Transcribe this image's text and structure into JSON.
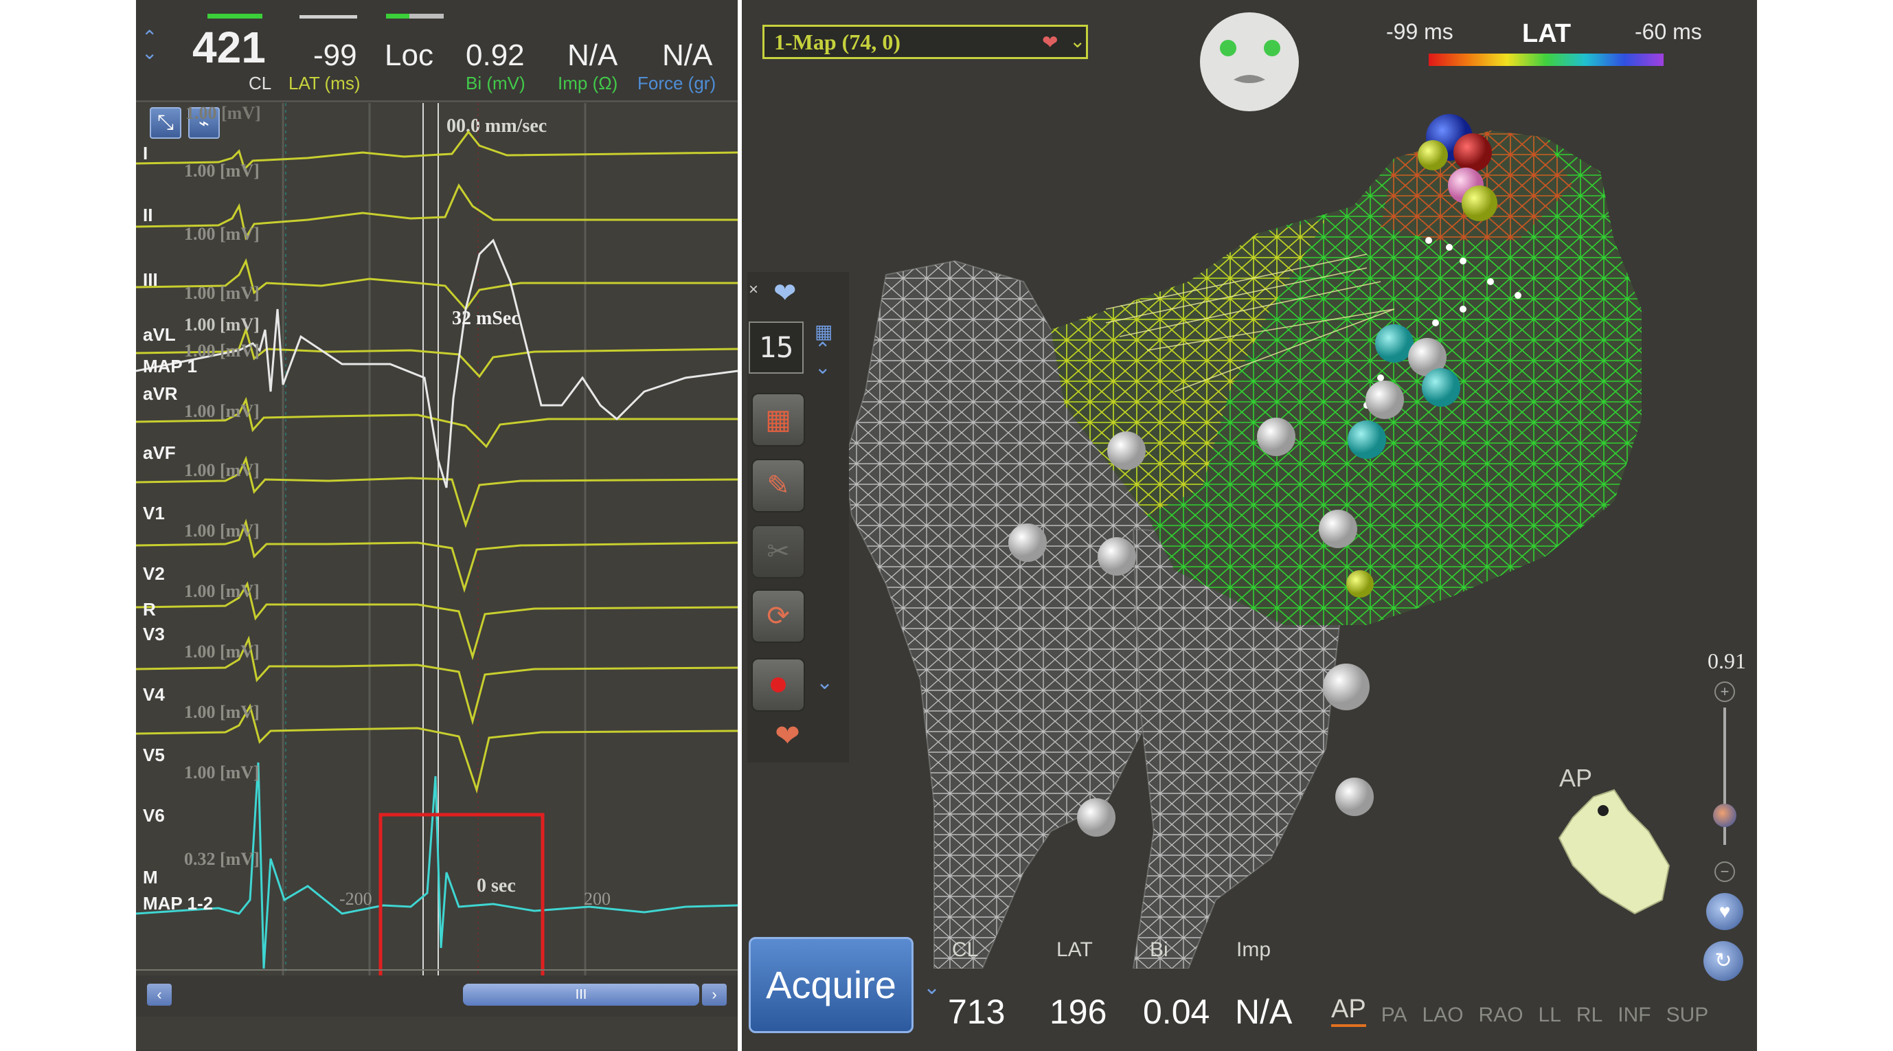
{
  "header": {
    "cl": {
      "value": "421",
      "label": "CL"
    },
    "lat": {
      "value": "-99",
      "label": "LAT (ms)"
    },
    "loc": {
      "value": "Loc"
    },
    "bi": {
      "value": "0.92",
      "label": "Bi (mV)"
    },
    "imp": {
      "value": "N/A",
      "label": "Imp (Ω)"
    },
    "force": {
      "value": "N/A",
      "label": "Force (gr)"
    }
  },
  "signals": {
    "sweep_speed": "00.0 mm/sec",
    "interval_label": "32 mSec",
    "time_label": "0 sec",
    "axis_left": "-200",
    "axis_right": "200",
    "top_gain": "1.00 [mV]",
    "leads": [
      {
        "name": "I",
        "gain": "1.00 [mV]"
      },
      {
        "name": "II",
        "gain": "1.00 [mV]"
      },
      {
        "name": "III",
        "gain": "1.00 [mV]"
      },
      {
        "name": "aVL",
        "gain": "1.00 [mV]"
      },
      {
        "name": "MAP 1",
        "gain": "1.00 [mV]"
      },
      {
        "name": "aVR",
        "gain": "1.00 [mV]"
      },
      {
        "name": "aVF",
        "gain": "1.00 [mV]"
      },
      {
        "name": "V1",
        "gain": "1.00 [mV]"
      },
      {
        "name": "V2",
        "gain": "1.00 [mV]"
      },
      {
        "name": "R",
        "gain": ""
      },
      {
        "name": "V3",
        "gain": "1.00 [mV]"
      },
      {
        "name": "V4",
        "gain": "1.00 [mV]"
      },
      {
        "name": "V5",
        "gain": "1.00 [mV]"
      },
      {
        "name": "V6",
        "gain": "1.00 [mV]"
      },
      {
        "name": "M",
        "gain": "0.32 [mV]"
      },
      {
        "name": "MAP 1-2",
        "gain": ""
      }
    ],
    "scrollbar_thumb": "III"
  },
  "map": {
    "title": "1-Map (74, 0)",
    "lat_min": "-99 ms",
    "lat_label": "LAT",
    "lat_max": "-60 ms",
    "point_count": "15",
    "zoom": "0.91",
    "orientation_label": "AP",
    "acquire_label": "Acquire",
    "stats_labels": {
      "cl": "CL",
      "lat": "LAT",
      "bi": "Bi",
      "imp": "Imp"
    },
    "stats_values": {
      "cl": "713",
      "lat": "196",
      "bi": "0.04",
      "imp": "N/A"
    },
    "views": [
      "AP",
      "PA",
      "LAO",
      "RAO",
      "LL",
      "RL",
      "INF",
      "SUP"
    ],
    "active_view": "AP"
  },
  "colors": {
    "panel_bg": "#3a3935",
    "trace_yellow": "#c8cf2e",
    "trace_white": "#e8e8e8",
    "trace_cyan": "#3fd6d2",
    "label_yellow": "#c6d23c",
    "label_green": "#42c94a",
    "label_blue": "#4f8ed8",
    "highlight_red": "#e02020",
    "acquire_blue": "#3f6fb0"
  }
}
